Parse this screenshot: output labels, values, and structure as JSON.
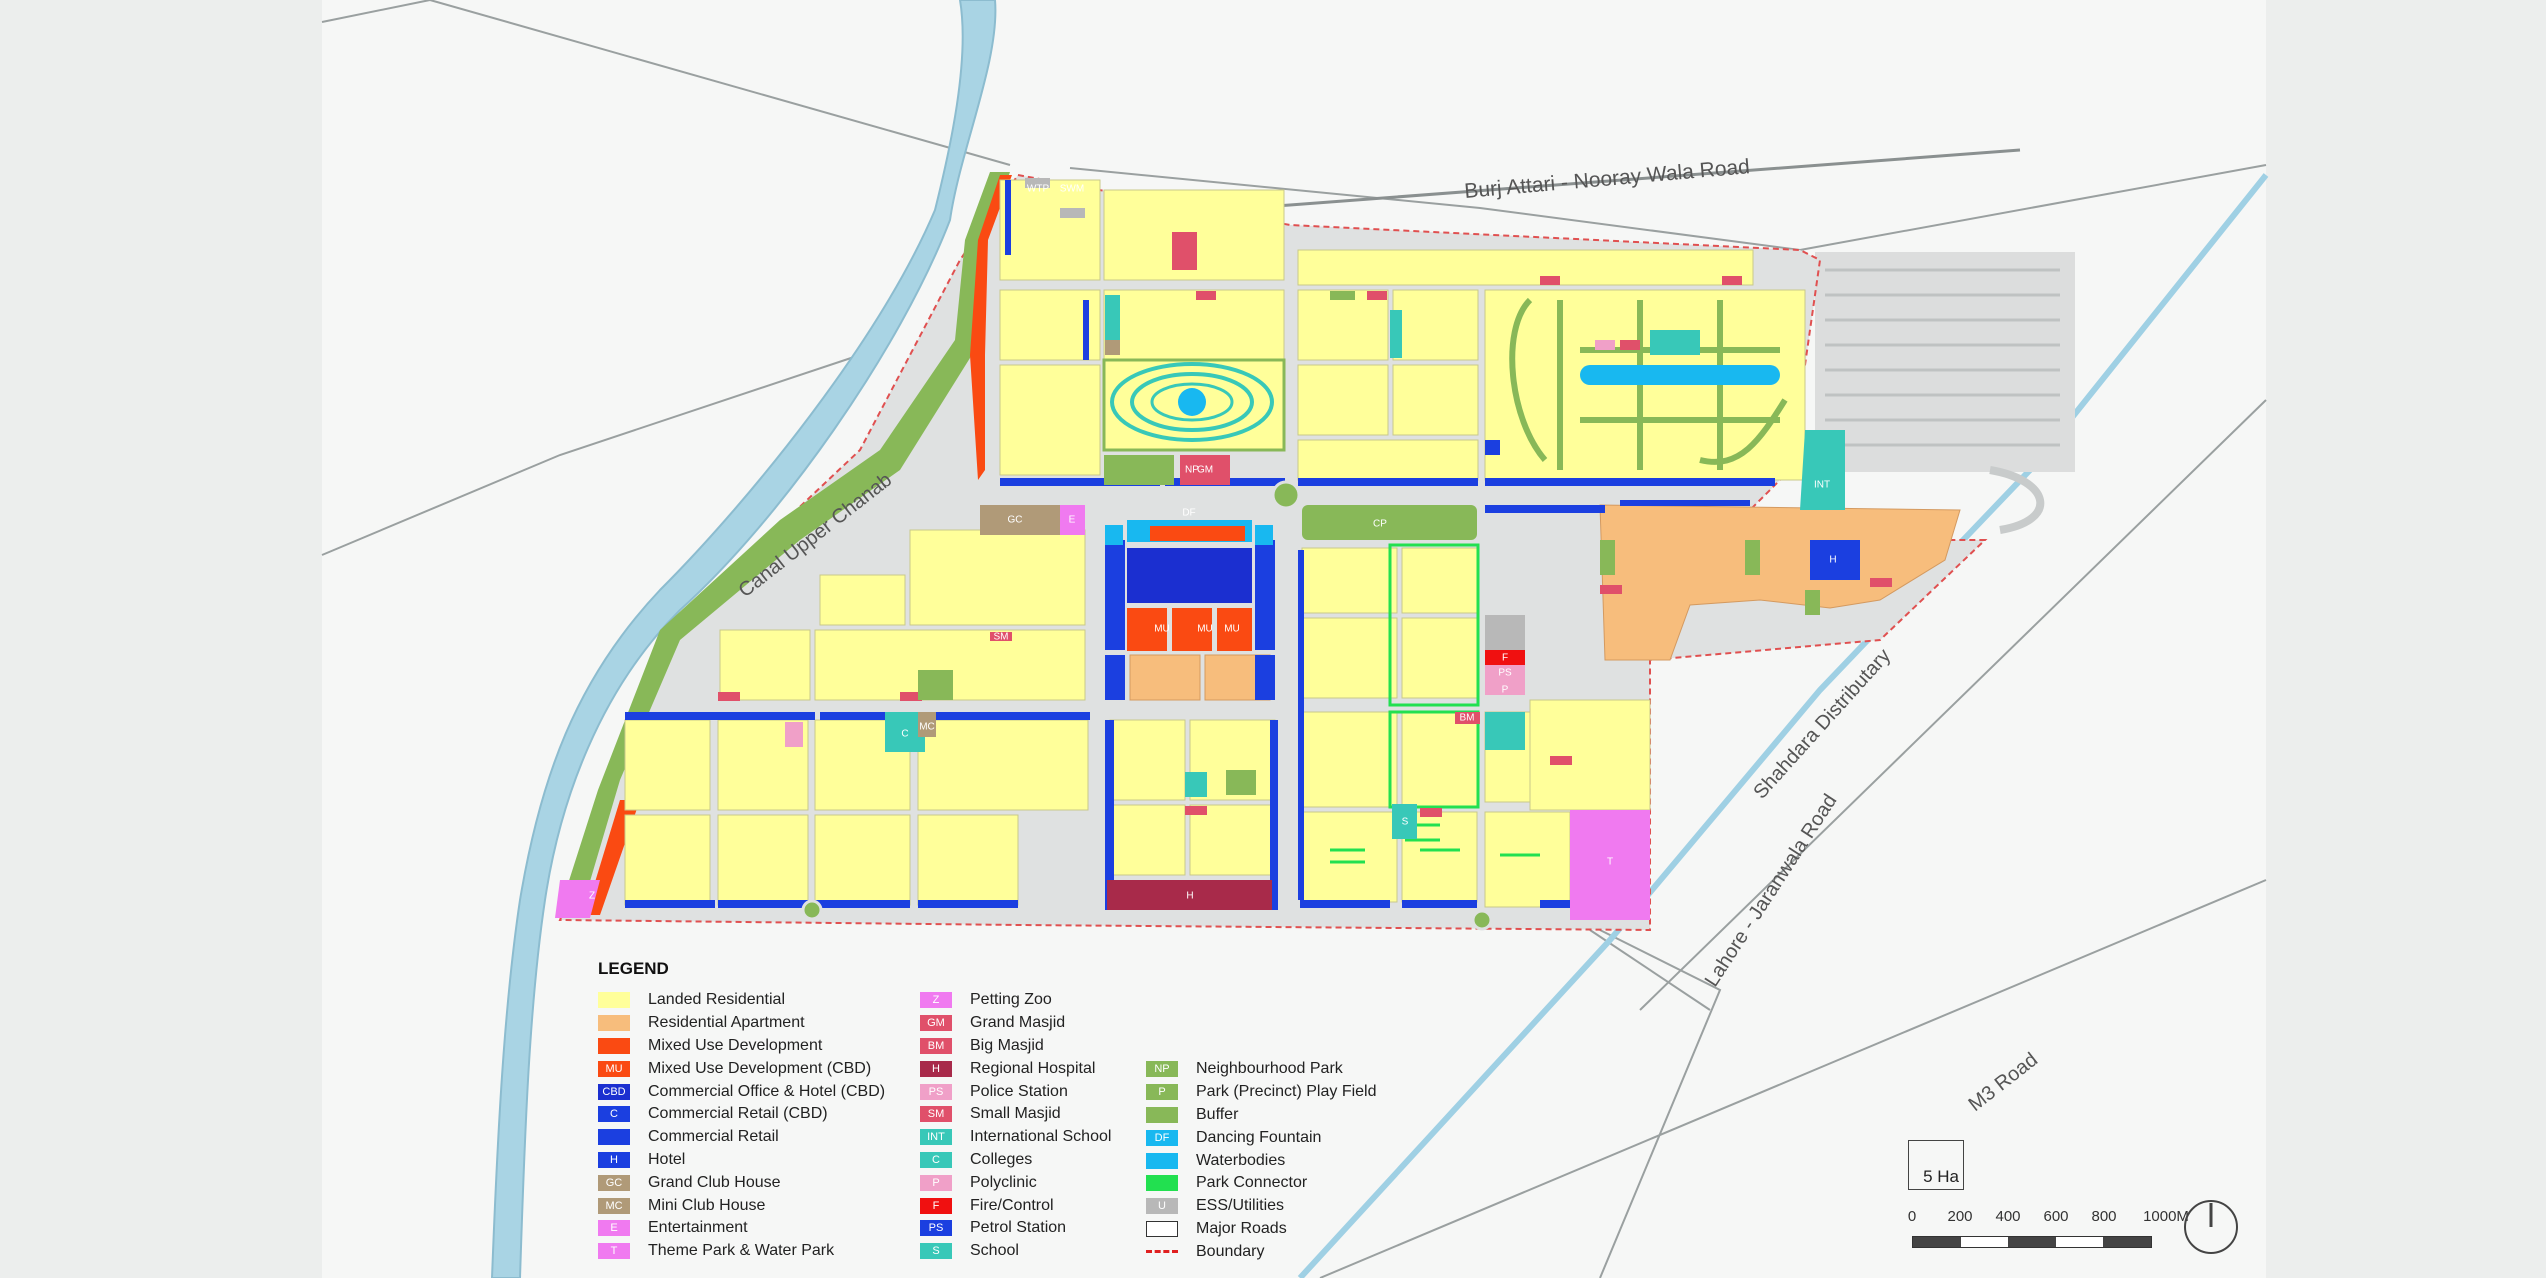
{
  "map_labels": {
    "road_top": "Burj Attari - Nooray Wala Road",
    "canal": "Canal Upper Chanab",
    "distributary": "Shahdara  Distributary",
    "road_lj": "Lahore - Jaranwala Road",
    "road_m3": "M3  Road"
  },
  "legend": {
    "title": "LEGEND",
    "col1": [
      {
        "code": "",
        "label": "Landed Residential",
        "color": "#ffff9a"
      },
      {
        "code": "",
        "label": "Residential Apartment",
        "color": "#f7bd7c"
      },
      {
        "code": "",
        "label": "Mixed Use Development",
        "color": "#fa4a12"
      },
      {
        "code": "MU",
        "label": "Mixed Use Development (CBD)",
        "color": "#fa4a12"
      },
      {
        "code": "CBD",
        "label": "Commercial Office & Hotel (CBD)",
        "color": "#1b2fd0"
      },
      {
        "code": "C",
        "label": "Commercial Retail (CBD)",
        "color": "#1b3fe0"
      },
      {
        "code": "",
        "label": "Commercial Retail",
        "color": "#1b3fe0"
      },
      {
        "code": "H",
        "label": "Hotel",
        "color": "#1b3fe0"
      },
      {
        "code": "GC",
        "label": "Grand Club House",
        "color": "#b09a78"
      },
      {
        "code": "MC",
        "label": "Mini Club House",
        "color": "#b09a78"
      },
      {
        "code": "E",
        "label": "Entertainment",
        "color": "#f07af0"
      },
      {
        "code": "T",
        "label": "Theme Park & Water Park",
        "color": "#f07af0"
      }
    ],
    "col2": [
      {
        "code": "Z",
        "label": "Petting Zoo",
        "color": "#f07af0"
      },
      {
        "code": "GM",
        "label": "Grand Masjid",
        "color": "#e0506a"
      },
      {
        "code": "BM",
        "label": "Big Masjid",
        "color": "#e0506a"
      },
      {
        "code": "H",
        "label": "Regional Hospital",
        "color": "#a82a4a"
      },
      {
        "code": "PS",
        "label": "Police Station",
        "color": "#f0a0c8"
      },
      {
        "code": "SM",
        "label": "Small Masjid",
        "color": "#e0506a"
      },
      {
        "code": "INT",
        "label": "International School",
        "color": "#38c8b8"
      },
      {
        "code": "C",
        "label": "Colleges",
        "color": "#38c8b8"
      },
      {
        "code": "P",
        "label": "Polyclinic",
        "color": "#f0a0c8"
      },
      {
        "code": "F",
        "label": "Fire/Control",
        "color": "#f01010"
      },
      {
        "code": "PS",
        "label": "Petrol Station",
        "color": "#1b3fe0"
      },
      {
        "code": "S",
        "label": "School",
        "color": "#38c8b8"
      }
    ],
    "col3": [
      {
        "code": "NP",
        "label": "Neighbourhood Park",
        "color": "#88b858"
      },
      {
        "code": "P",
        "label": "Park (Precinct) Play Field",
        "color": "#88b858"
      },
      {
        "code": "",
        "label": "Buffer",
        "color": "#88b858"
      },
      {
        "code": "DF",
        "label": "Dancing Fountain",
        "color": "#18b8f0"
      },
      {
        "code": "",
        "label": "Waterbodies",
        "color": "#18b8f0"
      },
      {
        "code": "",
        "label": "Park Connector",
        "color": "#22e050"
      },
      {
        "code": "U",
        "label": "ESS/Utilities",
        "color": "#b8b8b8"
      },
      {
        "code": "",
        "label": "Major Roads",
        "color": "#ffffff"
      },
      {
        "code": "",
        "label": "Boundary",
        "color": "#e02020"
      }
    ]
  },
  "scale": {
    "area_label": "5 Ha",
    "ticks": [
      "0",
      "200",
      "400",
      "600",
      "800",
      "1000M"
    ]
  },
  "plot_labels": {
    "np": "NP",
    "gm": "GM",
    "df": "DF",
    "mu": "MU",
    "gc": "GC",
    "e": "E",
    "cp": "CP",
    "h": "H",
    "int": "INT",
    "t": "T",
    "z": "Z",
    "f": "F",
    "ps": "PS",
    "p": "P",
    "mc": "MC",
    "c": "C",
    "sm": "SM",
    "bm": "BM",
    "s": "S",
    "wtp": "WTP",
    "swm": "SWM"
  }
}
